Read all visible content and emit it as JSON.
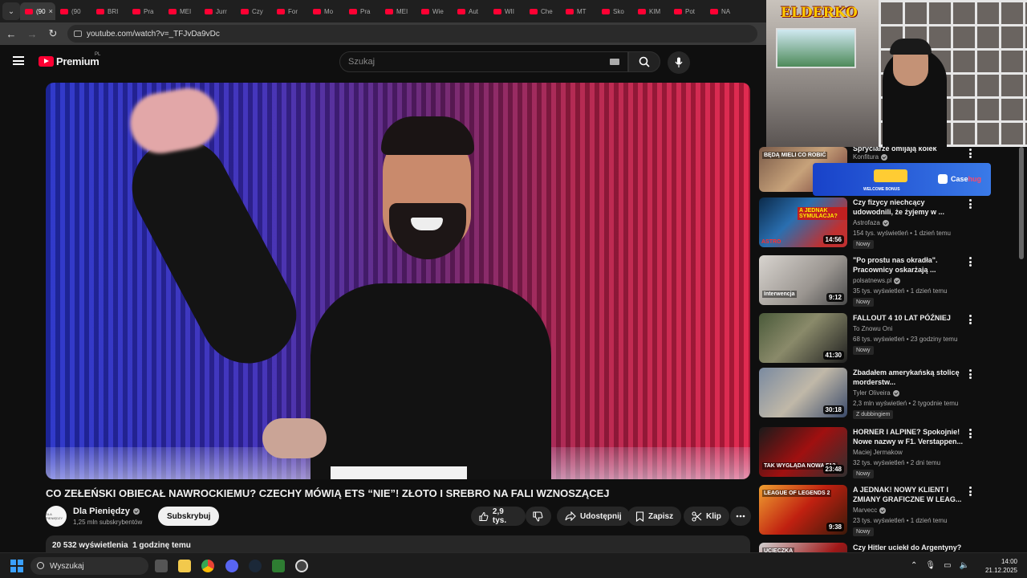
{
  "browser": {
    "tabs": [
      "(90",
      "(90",
      "BRI",
      "Pra",
      "MEI",
      "Jurr",
      "Czy",
      "For",
      "Mo",
      "Pra",
      "MEI",
      "Wie",
      "Aut",
      "WII",
      "Che",
      "MT",
      "Sko",
      "KIM",
      "Pot",
      "NA"
    ],
    "url": "youtube.com/watch?v=_TFJvDa9vDc"
  },
  "youtube": {
    "logo_text": "Premium",
    "logo_region": "PL",
    "search_placeholder": "Szukaj"
  },
  "video": {
    "title": "CO ZEŁEŃSKI OBIECAŁ NAWROCKIEMU? CZECHY MÓWIĄ ETS “NIE”! ZŁOTO I SREBRO NA FALI WZNOSZĄCEJ",
    "channel": "Dla Pieniędzy",
    "channel_avatar_text": "DLA PIENIĘDZY",
    "subscribers": "1,25 mln subskrybentów",
    "subscribe_label": "Subskrybuj",
    "likes": "2,9 tys.",
    "share_label": "Udostępnij",
    "save_label": "Zapisz",
    "clip_label": "Klip",
    "views": "20 532 wyświetlenia",
    "uploaded": "1 godzinę temu"
  },
  "recommendations": [
    {
      "title": "Spryciarze omijają kolek",
      "channel": "Konfitura",
      "verified": true,
      "meta": "",
      "duration": "",
      "badge": ""
    },
    {
      "title": "Czy fizycy niechcący udowodnili, że żyjemy w ...",
      "channel": "Astrofaza",
      "verified": true,
      "meta": "154 tys. wyświetleń • 1 dzień temu",
      "duration": "14:56",
      "badge": "Nowy"
    },
    {
      "title": "\"Po prostu nas okradła\". Pracownicy oskarżają ...",
      "channel": "polsatnews.pl",
      "verified": true,
      "meta": "35 tys. wyświetleń • 1 dzień temu",
      "duration": "9:12",
      "badge": "Nowy"
    },
    {
      "title": "FALLOUT 4 10 LAT PÓŹNIEJ",
      "channel": "To Znowu Oni",
      "verified": false,
      "meta": "68 tys. wyświetleń • 23 godziny temu",
      "duration": "41:30",
      "badge": "Nowy"
    },
    {
      "title": "Zbadałem amerykańską stolicę morderstw...",
      "channel": "Tyler Oliveira",
      "verified": true,
      "meta": "2,3 mln wyświetleń • 2 tygodnie temu",
      "duration": "30:18",
      "badge": "Z dubbingiem"
    },
    {
      "title": "HORNER I ALPINE? Spokojnie! Nowe nazwy w F1. Verstappen...",
      "channel": "Maciej Jermakow",
      "verified": false,
      "meta": "32 tys. wyświetleń • 2 dni temu",
      "duration": "23:48",
      "badge": "Nowy"
    },
    {
      "title": "A JEDNAK! NOWY KLIENT I ZMIANY GRAFICZNE W LEAG...",
      "channel": "Marvecc",
      "verified": true,
      "meta": "23 tys. wyświetleń • 1 dzień temu",
      "duration": "9:38",
      "badge": "Nowy"
    },
    {
      "title": "Czy Hitler uciekł do Argentyny?",
      "channel": "",
      "verified": false,
      "meta": "",
      "duration": "",
      "badge": ""
    }
  ],
  "thumb_texts": {
    "rec0": "BĘDĄ MIELI CO ROBIĆ",
    "rec1": "A JEDNAK SYMULACJA?",
    "rec1_logo": "ASTRO",
    "rec2": "Interwencja",
    "rec5": "TAK WYGLĄDA NOWA F1?",
    "rec6": "LEAGUE OF LEGENDS 2",
    "rec7": "UCIECZKA"
  },
  "overlay": {
    "stream_logo": "ELDERKO",
    "ad_bonus": "WELCOME BONUS",
    "ad_brand_a": "Case",
    "ad_brand_b": "hug"
  },
  "taskbar": {
    "search": "Wyszukaj",
    "time": "14:00",
    "date": "21.12.2025"
  },
  "colors": {
    "accent": "#ff0033",
    "background": "#0f0f0f",
    "chip": "#272727"
  }
}
